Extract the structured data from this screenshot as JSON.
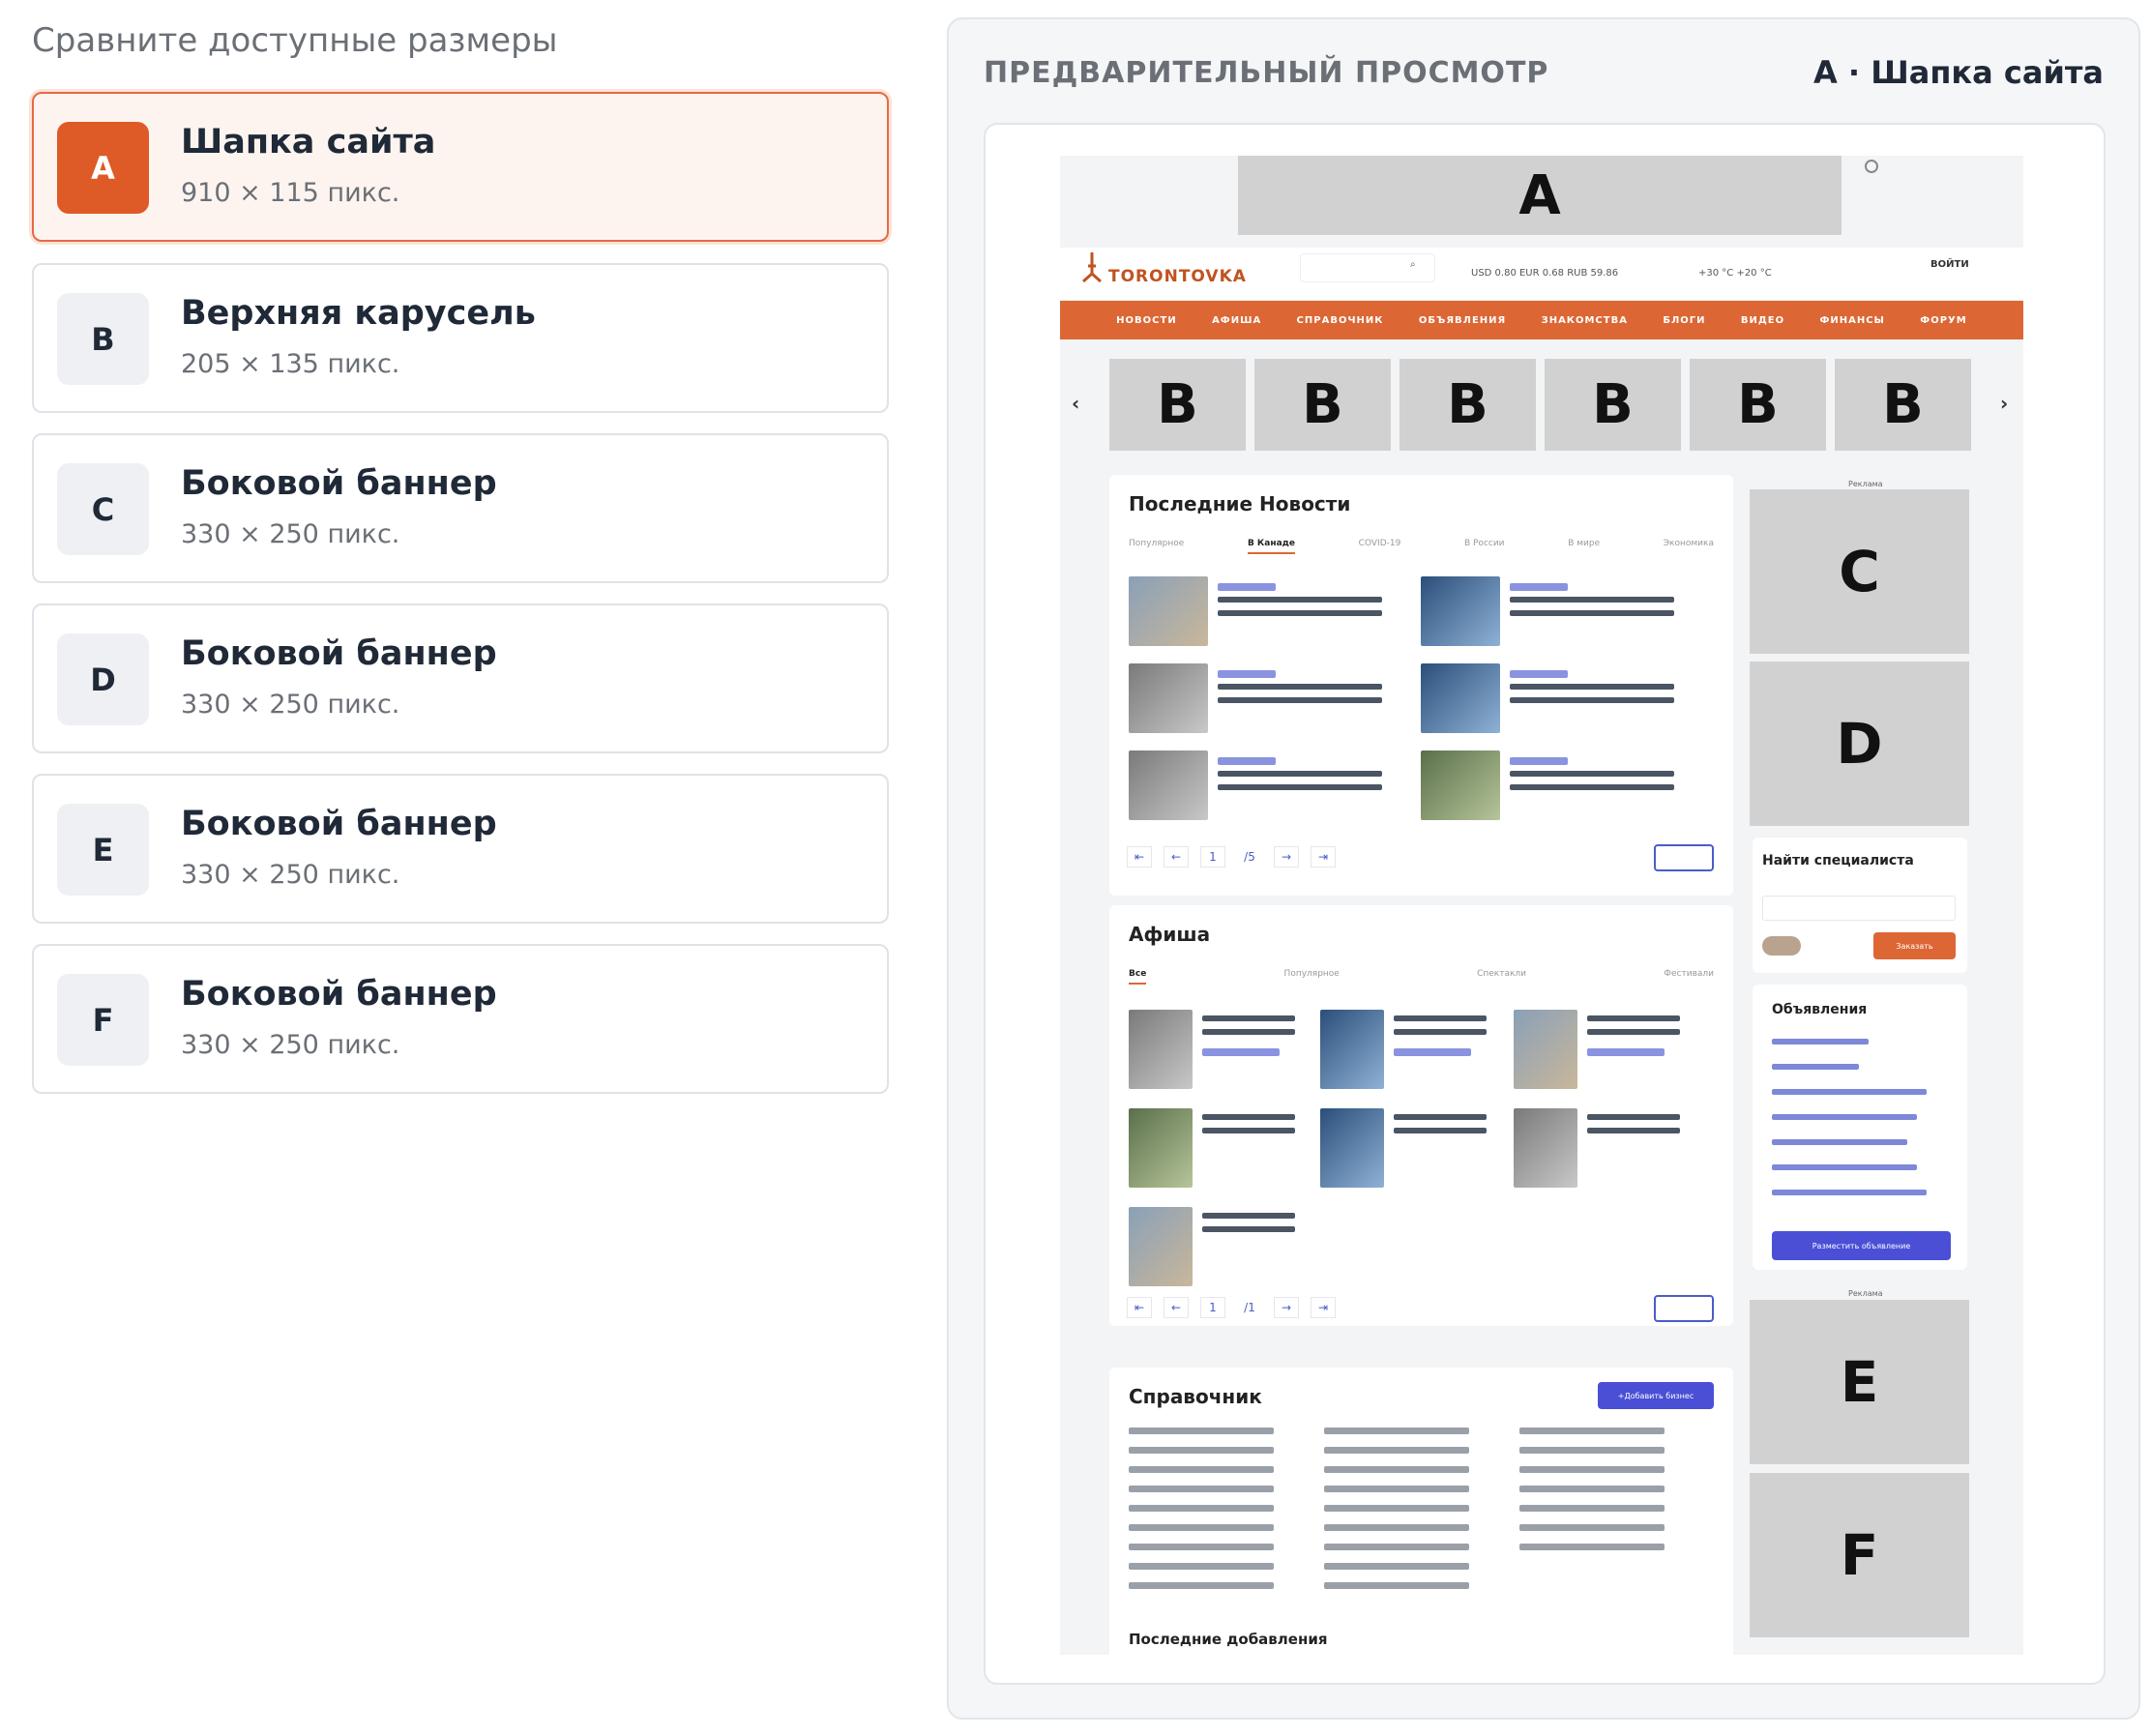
{
  "left": {
    "title": "Сравните доступные размеры",
    "options": [
      {
        "letter": "A",
        "title": "Шапка сайта",
        "size": "910 × 115 пикс.",
        "selected": true
      },
      {
        "letter": "B",
        "title": "Верхняя карусель",
        "size": "205 × 135 пикс.",
        "selected": false
      },
      {
        "letter": "C",
        "title": "Боковой баннер",
        "size": "330 × 250 пикс.",
        "selected": false
      },
      {
        "letter": "D",
        "title": "Боковой баннер",
        "size": "330 × 250 пикс.",
        "selected": false
      },
      {
        "letter": "E",
        "title": "Боковой баннер",
        "size": "330 × 250 пикс.",
        "selected": false
      },
      {
        "letter": "F",
        "title": "Боковой баннер",
        "size": "330 × 250 пикс.",
        "selected": false
      }
    ]
  },
  "preview": {
    "title": "ПРЕДВАРИТЕЛЬНЫЙ ПРОСМОТР",
    "selection": "A · Шапка сайта",
    "site": {
      "logo": "TORONTOVKA",
      "rates": "USD 0.80   EUR 0.68   RUB 59.86",
      "weather": "+30 °C   +20 °C",
      "login": "ВОЙТИ",
      "nav": [
        "НОВОСТИ",
        "АФИША",
        "СПРАВОЧНИК",
        "ОБЪЯВЛЕНИЯ",
        "ЗНАКОМСТВА",
        "БЛОГИ",
        "ВИДЕО",
        "ФИНАНСЫ",
        "ФОРУМ"
      ],
      "slots": {
        "a": "A",
        "b": "B",
        "c": "C",
        "d": "D",
        "e": "E",
        "f": "F"
      },
      "news": {
        "title": "Последние Новости",
        "tabs": [
          "Популярное",
          "В Канаде",
          "COVID-19",
          "В России",
          "В мире",
          "Экономика"
        ],
        "pages": "/5"
      },
      "afisha": {
        "title": "Афиша",
        "tabs": [
          "Все",
          "Популярное",
          "Спектакли",
          "Фестивали"
        ],
        "pages": "/1"
      },
      "directory": {
        "title": "Справочник",
        "add": "+Добавить бизнес",
        "recent": "Последние добавления"
      },
      "find": {
        "title": "Найти специалиста",
        "btn": "Заказать"
      },
      "ads": {
        "title": "Объявления",
        "btn": "Разместить объявление"
      },
      "ad_label": "Реклама"
    }
  }
}
